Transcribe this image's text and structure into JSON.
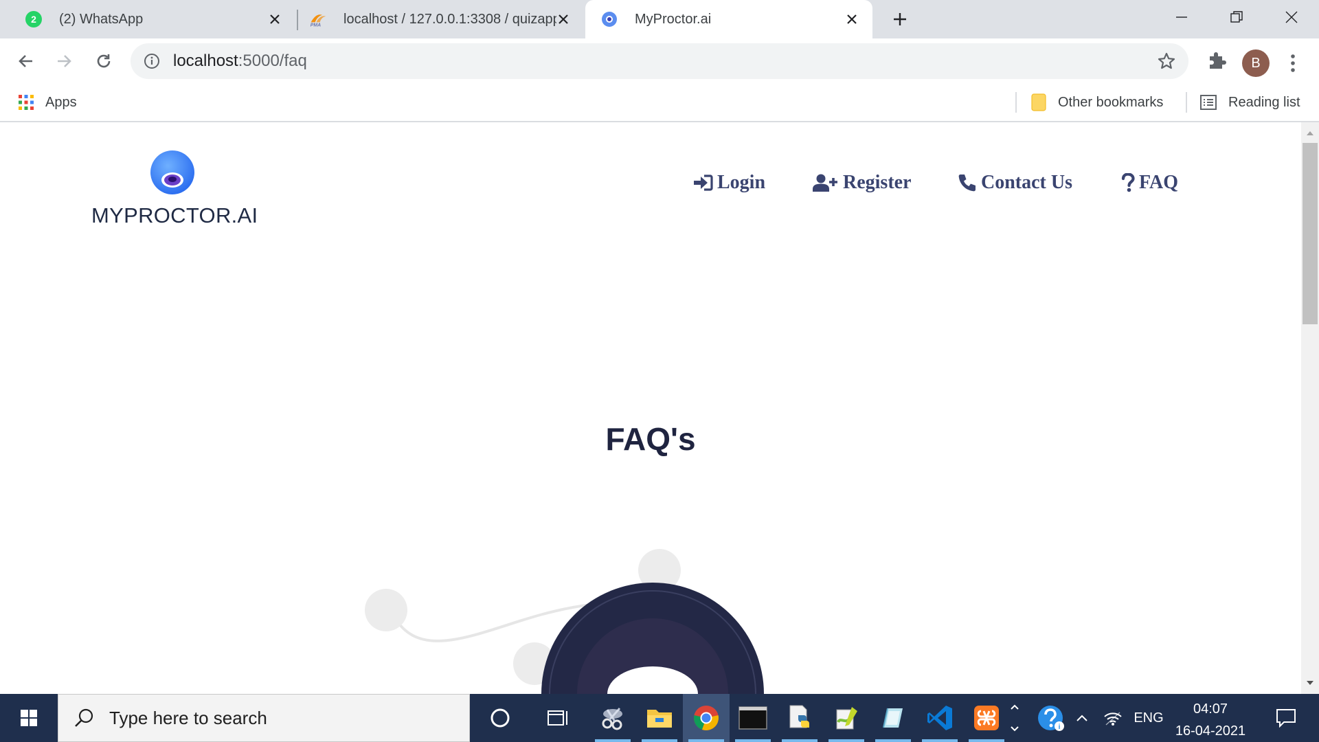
{
  "browser": {
    "tabs": [
      {
        "title": "(2) WhatsApp",
        "badge": "2",
        "icon": "whatsapp-icon"
      },
      {
        "title": "localhost / 127.0.0.1:3308 / quizapp",
        "favicon_text": "PMA",
        "icon": "phpmyadmin-icon"
      },
      {
        "title": "MyProctor.ai",
        "icon": "myproctor-favicon"
      }
    ],
    "address": {
      "host": "localhost",
      "path": ":5000/faq"
    },
    "profile_initial": "B",
    "bookmarks": {
      "apps": "Apps",
      "other": "Other bookmarks",
      "reading": "Reading list"
    }
  },
  "page": {
    "brand": "MYPROCTOR.AI",
    "nav": [
      {
        "label": "Login",
        "icon": "sign-in-icon"
      },
      {
        "label": "Register",
        "icon": "user-plus-icon"
      },
      {
        "label": "Contact Us",
        "icon": "phone-icon"
      },
      {
        "label": "FAQ",
        "icon": "question-icon"
      }
    ],
    "heading": "FAQ's"
  },
  "taskbar": {
    "search_placeholder": "Type here to search",
    "lang": "ENG",
    "time": "04:07",
    "date": "16-04-2021"
  },
  "colors": {
    "nav_text": "#3a4470",
    "brand_text": "#1f2a44",
    "taskbar_bg": "#1f2f4d",
    "tab_strip": "#dee1e6"
  }
}
